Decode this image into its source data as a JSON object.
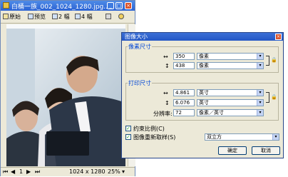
{
  "viewer": {
    "title": "白桶一族_002_1024_1280.jpg...",
    "window_controls": {
      "minimize": "_",
      "maximize": "□",
      "close": "×"
    },
    "toolbar": {
      "original": "原始",
      "preview": "预览",
      "two_up": "2 幅",
      "four_up": "4 幅"
    },
    "status": {
      "page": "1",
      "dimensions": "1024 x 1280",
      "zoom": "25%"
    }
  },
  "dialog": {
    "title": "图像大小",
    "pixel_size": {
      "label": "像素尺寸",
      "width": "350",
      "width_unit": "像素",
      "height": "438",
      "height_unit": "像素"
    },
    "print_size": {
      "label": "打印尺寸",
      "width": "4.861",
      "width_unit": "英寸",
      "height": "6.076",
      "height_unit": "英寸",
      "resolution_label": "分辨率:",
      "resolution": "72",
      "resolution_unit": "像素／英寸"
    },
    "constrain_label": "约束比例(C)",
    "constrain_checked": true,
    "resample_label": "图像重新取样(S)",
    "resample_checked": true,
    "resample_method": "双立方",
    "ok": "确定",
    "cancel": "取消"
  },
  "colors": {
    "titlebar": "#2a62d4",
    "dialog_title": "#2457c5",
    "group_label": "#0046d5",
    "face": "#ece9d8"
  }
}
